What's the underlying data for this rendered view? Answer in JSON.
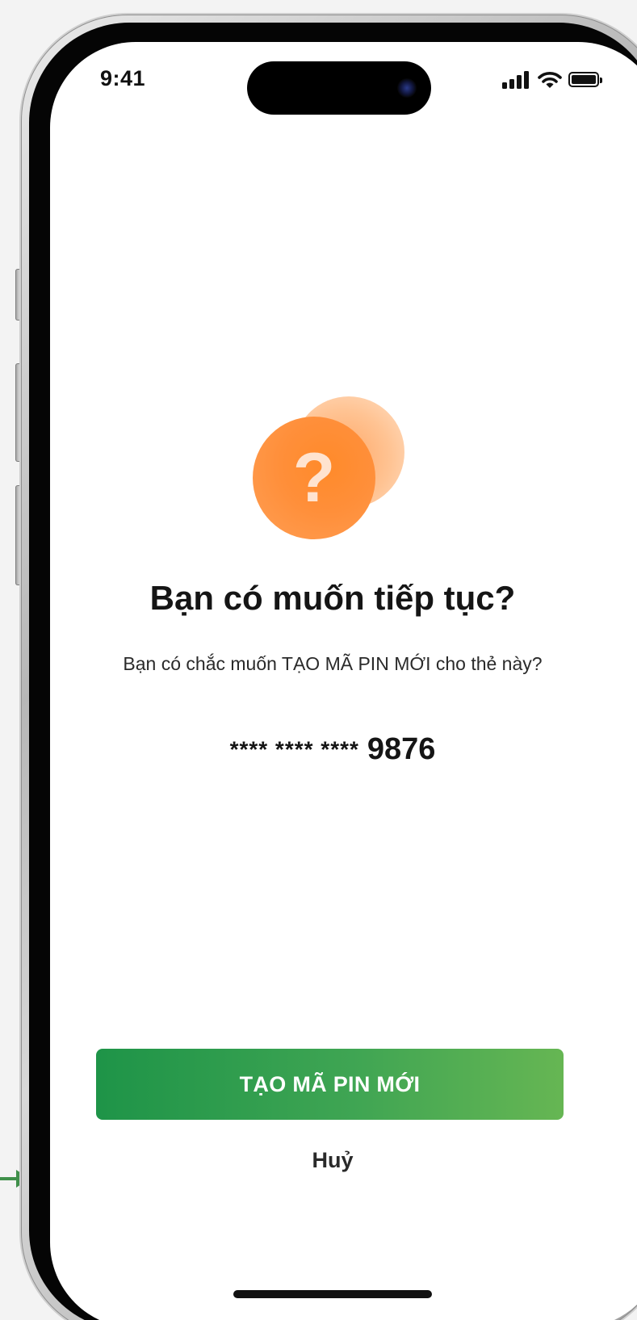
{
  "colors": {
    "accent_green": "#2e9e4c",
    "accent_orange": "#ff8a2a",
    "text_primary": "#151515",
    "annotation_arrow": "#3f8f4a"
  },
  "status_bar": {
    "time": "9:41",
    "icons": [
      "signal-icon",
      "wifi-icon",
      "battery-icon"
    ]
  },
  "dialog": {
    "icon": "question-mark-icon",
    "icon_glyph": "?",
    "title": "Bạn có muốn tiếp tục?",
    "message": "Bạn có chắc muốn TẠO MÃ PIN MỚI cho thẻ này?",
    "card_number_mask": "**** **** ****",
    "card_number_last4": "9876"
  },
  "actions": {
    "primary_label": "TẠO MÃ PIN MỚI",
    "cancel_label": "Huỷ"
  }
}
